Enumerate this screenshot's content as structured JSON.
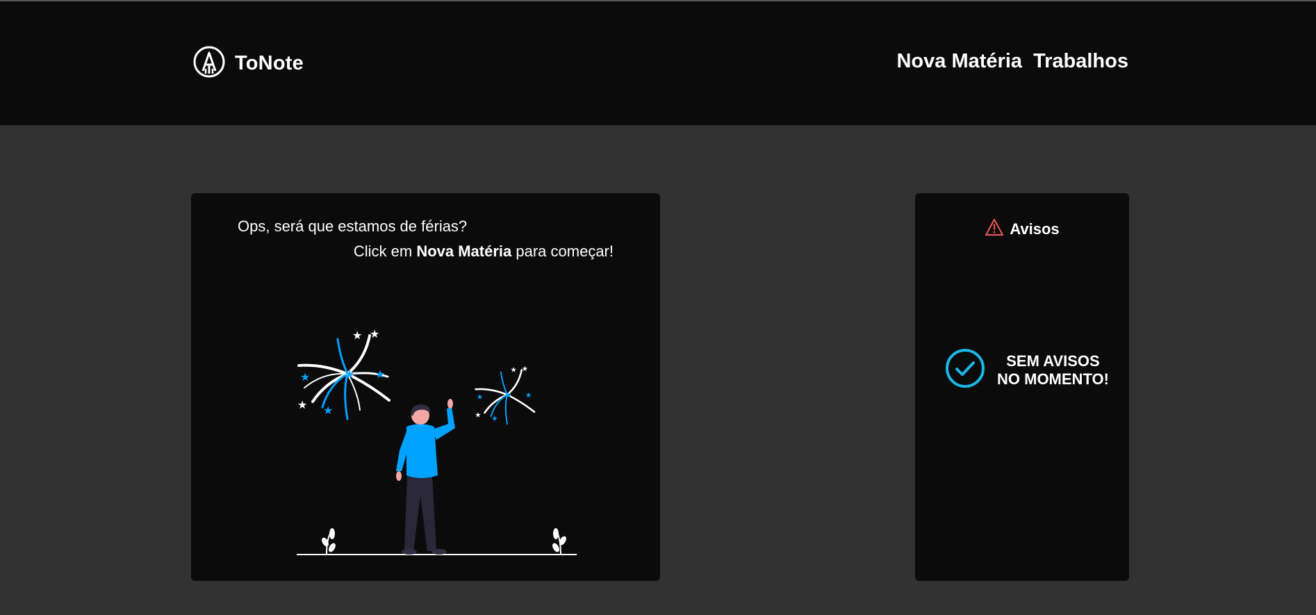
{
  "app": {
    "name": "ToNote",
    "logo_icon": "pencil-circle-icon"
  },
  "nav": {
    "items": [
      {
        "label": "Nova Matéria"
      },
      {
        "label": "Trabalhos"
      }
    ]
  },
  "main_card": {
    "message_line1": "Ops, será que estamos de férias?",
    "message_line2_prefix": "Click em ",
    "message_line2_bold": "Nova Matéria",
    "message_line2_suffix": " para começar!",
    "illustration": "person-watching-fireworks"
  },
  "notices": {
    "title": "Avisos",
    "title_icon": "warning-triangle-icon",
    "empty_icon": "check-circle-icon",
    "empty_line1": "SEM AVISOS",
    "empty_line2": "NO MOMENTO!"
  },
  "colors": {
    "accent_blue": "#00a2ff",
    "check_blue": "#1ab8e8",
    "warning_red": "#e05656",
    "header_bg": "#0b0b0b",
    "page_bg": "#323232"
  }
}
